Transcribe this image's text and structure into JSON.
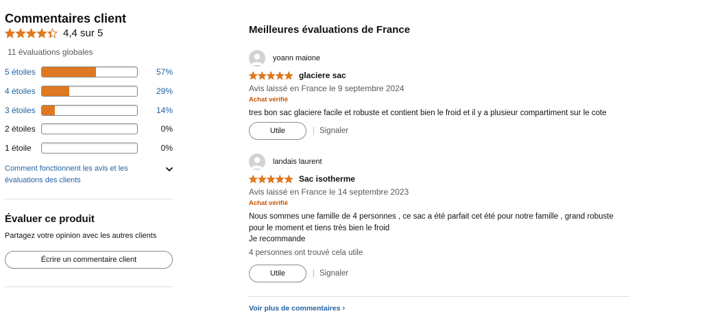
{
  "summary": {
    "title": "Commentaires client",
    "average_rating": 4.4,
    "average_text": "4,4 sur 5",
    "global_ratings": "11 évaluations globales",
    "histogram": [
      {
        "label": "5 étoiles",
        "percent": 57,
        "percent_text": "57%",
        "is_link": true
      },
      {
        "label": "4 étoiles",
        "percent": 29,
        "percent_text": "29%",
        "is_link": true
      },
      {
        "label": "3 étoiles",
        "percent": 14,
        "percent_text": "14%",
        "is_link": true
      },
      {
        "label": "2 étoiles",
        "percent": 0,
        "percent_text": "0%",
        "is_link": false
      },
      {
        "label": "1 étoile",
        "percent": 0,
        "percent_text": "0%",
        "is_link": false
      }
    ],
    "how_it_works_link": "Comment fonctionnent les avis et les évaluations des clients"
  },
  "evaluate": {
    "title": "Évaluer ce produit",
    "subtitle": "Partagez votre opinion avec les autres clients",
    "button_label": "Écrire un commentaire client"
  },
  "top_reviews": {
    "title": "Meilleures évaluations de France",
    "reviews": [
      {
        "author": "yoann maione",
        "rating": 5,
        "title": "glaciere sac",
        "date": "Avis laissé en France le 9 septembre 2024",
        "verified": "Achat vérifié",
        "body": "tres bon sac glaciere facile et robuste et contient bien le froid et il y a plusieur compartiment sur le cote",
        "helpful": "",
        "utile_label": "Utile",
        "signaler_label": "Signaler"
      },
      {
        "author": "landais laurent",
        "rating": 5,
        "title": "Sac isotherme",
        "date": "Avis laissé en France le 14 septembre 2023",
        "verified": "Achat vérifié",
        "body_lines": [
          "Nous sommes une famille de 4 personnes , ce sac a été parfait cet été pour notre famille , grand robuste pour le moment et tiens très bien le froid",
          "Je recommande"
        ],
        "helpful": "4 personnes ont trouvé cela utile",
        "utile_label": "Utile",
        "signaler_label": "Signaler"
      }
    ],
    "more_link": "Voir plus de commentaires",
    "more_chevron": "›"
  },
  "colors": {
    "star": "#de7921",
    "link": "#2162a1",
    "verified": "#c45500",
    "muted": "#565959"
  }
}
